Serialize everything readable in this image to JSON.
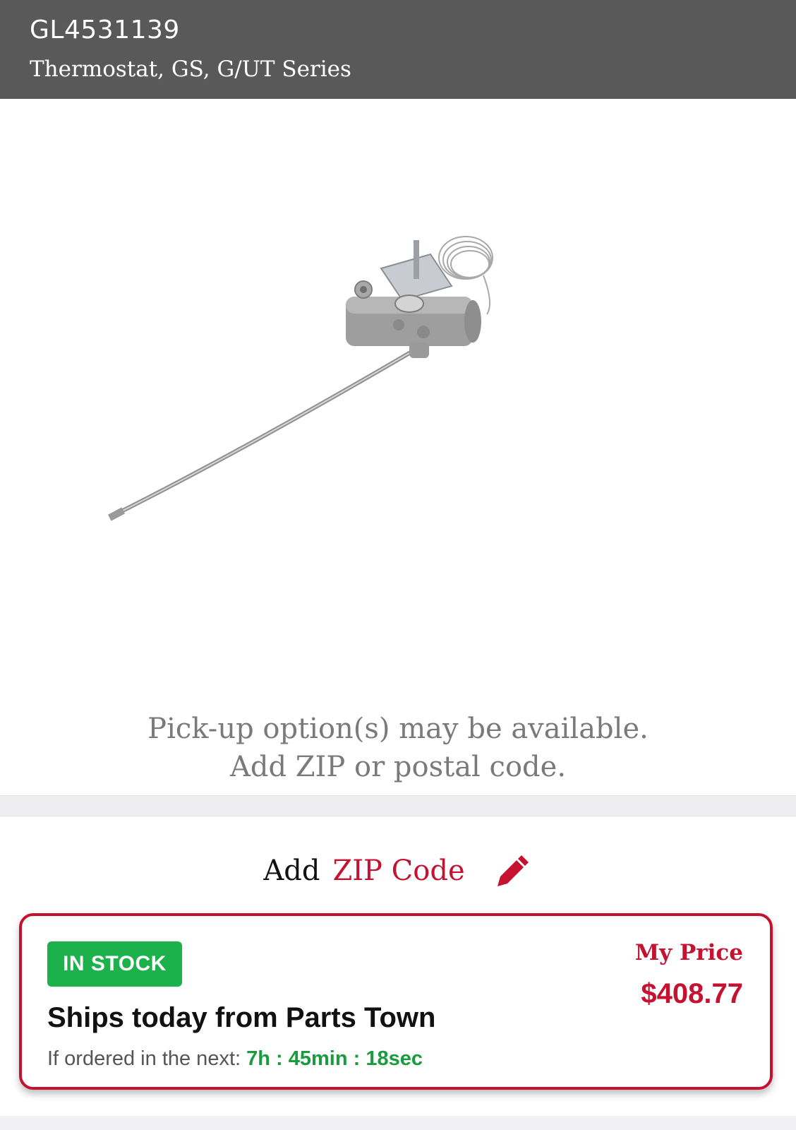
{
  "header": {
    "part_number": "GL4531139",
    "description": "Thermostat, GS, G/UT Series"
  },
  "product": {
    "image_icon": "thermostat-product-image"
  },
  "pickup": {
    "line1": "Pick-up option(s) may be available.",
    "line2": "Add ZIP or postal code."
  },
  "zip": {
    "prefix": "Add",
    "link_label": "ZIP Code",
    "edit_icon": "pencil-icon"
  },
  "stock": {
    "badge": "IN STOCK",
    "ships": "Ships today from Parts Town",
    "order_prefix": "If ordered in the next: ",
    "countdown": "7h : 45min : 18sec"
  },
  "price": {
    "label": "My Price",
    "value": "$408.77"
  },
  "colors": {
    "header_bg": "#595959",
    "brand_red": "#c41230",
    "stock_green": "#1db14b",
    "timer_green": "#1a9c3e"
  }
}
